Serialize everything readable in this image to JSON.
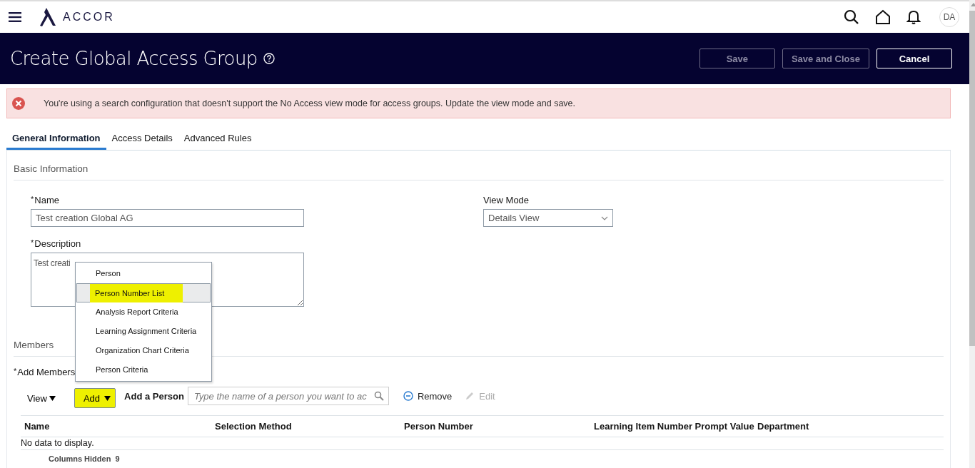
{
  "header": {
    "logo": "ACCOR",
    "avatar": "DA"
  },
  "page": {
    "title": "Create Global Access Group",
    "buttons": [
      {
        "label": "Save",
        "disabled": true
      },
      {
        "label": "Save and Close",
        "disabled": true
      },
      {
        "label": "Cancel",
        "disabled": false
      }
    ]
  },
  "alert": {
    "message": "You're using a search configuration that doesn't support the No Access view mode for access groups. Update the view mode and save."
  },
  "tabs": [
    {
      "label": "General Information",
      "selected": true
    },
    {
      "label": "Access Details",
      "selected": false
    },
    {
      "label": "Advanced Rules",
      "selected": false
    }
  ],
  "basic_information": {
    "heading": "Basic Information",
    "name": {
      "label": "Name",
      "required": true,
      "value": "Test creation Global AG"
    },
    "view_mode": {
      "label": "View Mode",
      "value": "Details View"
    },
    "required_mark": "*",
    "description": {
      "label": "Description",
      "required": true,
      "value": "Test creati"
    }
  },
  "members": {
    "heading": "Members",
    "add_members_label": "Add Members",
    "required": true,
    "toolbar": {
      "view": "View",
      "add": "Add",
      "add_highlighted": true,
      "add_person_label": "Add a Person",
      "search_placeholder": "Type the name of a person you want to ac",
      "remove": "Remove",
      "edit": "Edit",
      "edit_disabled": true
    },
    "add_menu": [
      {
        "label": "Person",
        "selected": false,
        "highlighted": false
      },
      {
        "label": "Person Number List",
        "selected": true,
        "highlighted": true
      },
      {
        "label": "Analysis Report Criteria",
        "selected": false,
        "highlighted": false
      },
      {
        "label": "Learning Assignment Criteria",
        "selected": false,
        "highlighted": false
      },
      {
        "label": "Organization Chart Criteria",
        "selected": false,
        "highlighted": false
      },
      {
        "label": "Person Criteria",
        "selected": false,
        "highlighted": false
      }
    ],
    "table": {
      "columns": [
        "Name",
        "Selection Method",
        "Person Number",
        "Learning Item Number Prompt Value",
        "Department"
      ],
      "empty_text": "No data to display.",
      "columns_hidden_label": "Columns Hidden",
      "columns_hidden_count": "9"
    }
  }
}
